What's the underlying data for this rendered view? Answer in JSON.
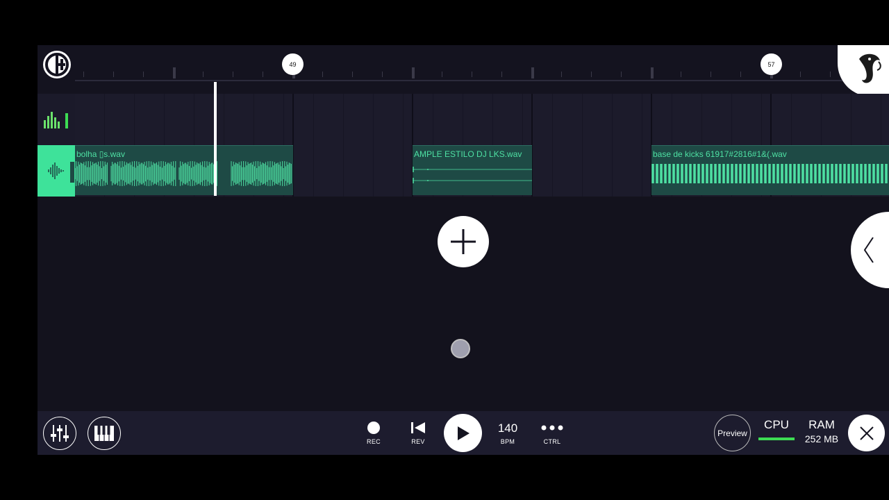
{
  "timeline": {
    "markers": [
      "49",
      "57"
    ]
  },
  "tracks": [
    {
      "clips": [
        {
          "label": "bolha ▯s.wav"
        },
        {
          "label": "AMPLE ESTILO DJ LKS.wav"
        },
        {
          "label": "base de kicks 61917#2816#1&(.wav"
        }
      ]
    }
  ],
  "transport": {
    "rec_label": "REC",
    "rev_label": "REV",
    "bpm_value": "140",
    "bpm_label": "BPM",
    "ctrl_label": "CTRL"
  },
  "status": {
    "preview_label": "Preview",
    "cpu_label": "CPU",
    "ram_label": "RAM",
    "ram_value": "252 MB"
  },
  "colors": {
    "accent": "#4ee0a3",
    "clip_bg": "#1e4a45",
    "background": "#14131f",
    "cpu_meter": "#3ddc53"
  },
  "icons": {
    "menu": "menu-icon",
    "fl_logo": "fl-logo-icon",
    "mixer": "mixer-icon",
    "piano": "piano-icon",
    "add": "plus-icon",
    "side_panel": "chevron-left-icon",
    "close": "close-icon"
  }
}
